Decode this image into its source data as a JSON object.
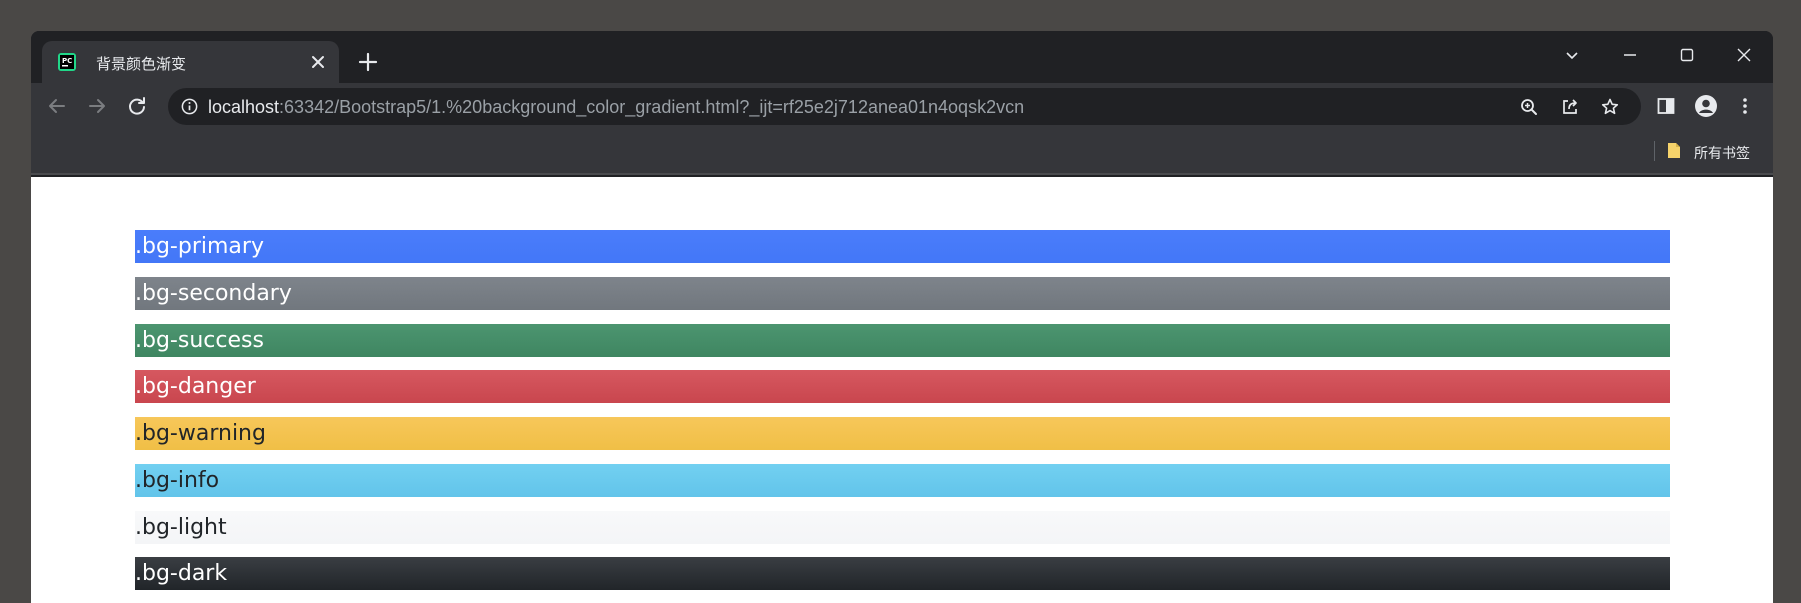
{
  "tab": {
    "title": "背景颜色渐变"
  },
  "address": {
    "host": "localhost",
    "rest": ":63342/Bootstrap5/1.%20background_color_gradient.html?_ijt=rf25e2j712anea01n4oqsk2vcn"
  },
  "bookmarks": {
    "all_label": "所有书签"
  },
  "bars": [
    {
      "label": ".bg-primary"
    },
    {
      "label": ".bg-secondary"
    },
    {
      "label": ".bg-success"
    },
    {
      "label": ".bg-danger"
    },
    {
      "label": ".bg-warning"
    },
    {
      "label": ".bg-info"
    },
    {
      "label": ".bg-light"
    },
    {
      "label": ".bg-dark"
    }
  ],
  "colors": {
    "frame": "#202124",
    "toolbar": "#35363a",
    "primary": "#4a7dfb",
    "secondary": "#7e848b",
    "success": "#4c9570",
    "danger": "#d65860",
    "warning": "#f7c75a",
    "info": "#72d0f1",
    "light": "#f8f9fa",
    "dark": "#212529"
  }
}
